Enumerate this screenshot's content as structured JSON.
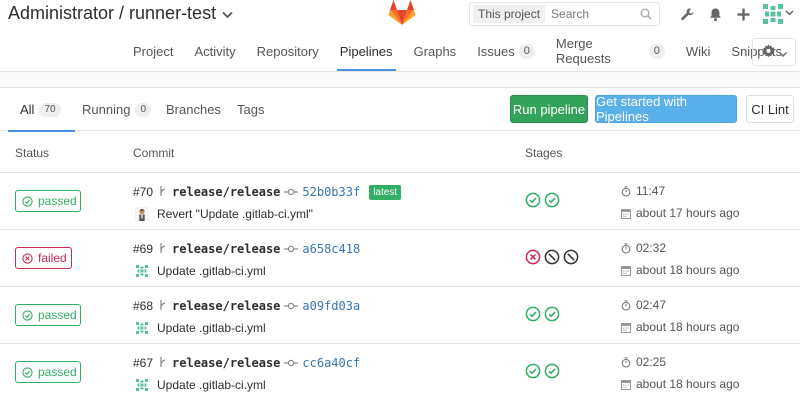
{
  "header": {
    "project_title": "Administrator / runner-test",
    "search_scope": "This project",
    "search_placeholder": "Search"
  },
  "nav": {
    "items": [
      {
        "label": "Project",
        "badge": null
      },
      {
        "label": "Activity",
        "badge": null
      },
      {
        "label": "Repository",
        "badge": null
      },
      {
        "label": "Pipelines",
        "badge": null,
        "active": true
      },
      {
        "label": "Graphs",
        "badge": null
      },
      {
        "label": "Issues",
        "badge": "0"
      },
      {
        "label": "Merge Requests",
        "badge": "0"
      },
      {
        "label": "Wiki",
        "badge": null
      },
      {
        "label": "Snippets",
        "badge": null
      }
    ]
  },
  "tabs": {
    "all": {
      "label": "All",
      "count": "70"
    },
    "running": {
      "label": "Running",
      "count": "0"
    },
    "branches": {
      "label": "Branches"
    },
    "tags": {
      "label": "Tags"
    }
  },
  "buttons": {
    "run_pipeline": "Run pipeline",
    "get_started": "Get started with Pipelines",
    "ci_lint": "CI Lint"
  },
  "table": {
    "headers": {
      "status": "Status",
      "commit": "Commit",
      "stages": "Stages"
    },
    "rows": [
      {
        "status": "passed",
        "id": "#70",
        "ref": "release/release",
        "sha": "52b0b33f",
        "latest": "latest",
        "message": "Revert \"Update .gitlab-ci.yml\"",
        "stages": [
          "success",
          "success"
        ],
        "duration": "11:47",
        "finished": "about 17 hours ago"
      },
      {
        "status": "failed",
        "id": "#69",
        "ref": "release/release",
        "sha": "a658c418",
        "latest": null,
        "message": "Update .gitlab-ci.yml",
        "stages": [
          "failed",
          "skipped",
          "skipped"
        ],
        "duration": "02:32",
        "finished": "about 18 hours ago"
      },
      {
        "status": "passed",
        "id": "#68",
        "ref": "release/release",
        "sha": "a09fd03a",
        "latest": null,
        "message": "Update .gitlab-ci.yml",
        "stages": [
          "success",
          "success"
        ],
        "duration": "02:47",
        "finished": "about 18 hours ago"
      },
      {
        "status": "passed",
        "id": "#67",
        "ref": "release/release",
        "sha": "cc6a40cf",
        "latest": null,
        "message": "Update .gitlab-ci.yml",
        "stages": [
          "success",
          "success"
        ],
        "duration": "02:25",
        "finished": "about 18 hours ago"
      }
    ]
  },
  "colors": {
    "success": "#31af64",
    "failed": "#d22852",
    "skipped": "#333333",
    "link": "#3777b0",
    "accent": "#4a90e2"
  },
  "icons": {
    "header": [
      "wrench-icon",
      "bell-icon",
      "plus-icon"
    ],
    "settings": "gear-icon"
  }
}
